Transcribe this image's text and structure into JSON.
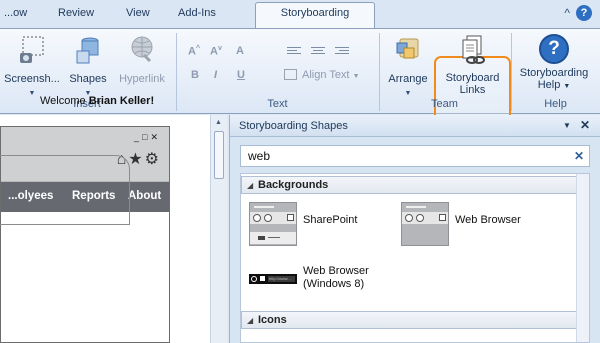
{
  "tabs": {
    "items": [
      "...ow",
      "Review",
      "View",
      "Add-Ins"
    ],
    "active": "Storyboarding"
  },
  "ribbon": {
    "insert": {
      "label": "Insert",
      "screenshot": "Screensh...",
      "shapes": "Shapes",
      "hyperlink": "Hyperlink"
    },
    "text": {
      "label": "Text",
      "align_text": "Align Text"
    },
    "team": {
      "label": "Team",
      "arrange": "Arrange",
      "storyboard_links_line1": "Storyboard",
      "storyboard_links_line2": "Links"
    },
    "help": {
      "label": "Help",
      "sb_help_line1": "Storyboarding",
      "sb_help_line2": "Help"
    }
  },
  "mock": {
    "nav": [
      "...olyees",
      "Reports",
      "About"
    ],
    "welcome_prefix": "Welcome ",
    "welcome_name": "Brian Keller!"
  },
  "pane": {
    "title": "Storyboarding Shapes",
    "search_value": "web",
    "sections": {
      "backgrounds": "Backgrounds",
      "icons": "Icons"
    },
    "shapes": {
      "sharepoint": "SharePoint",
      "web_browser": "Web Browser",
      "web_browser_w8_line1": "Web Browser",
      "web_browser_w8_line2": "(Windows 8)",
      "w8_url": "http://www..."
    }
  },
  "colors": {
    "highlight": "#f08a1c",
    "help_blue": "#2f6fc2"
  }
}
